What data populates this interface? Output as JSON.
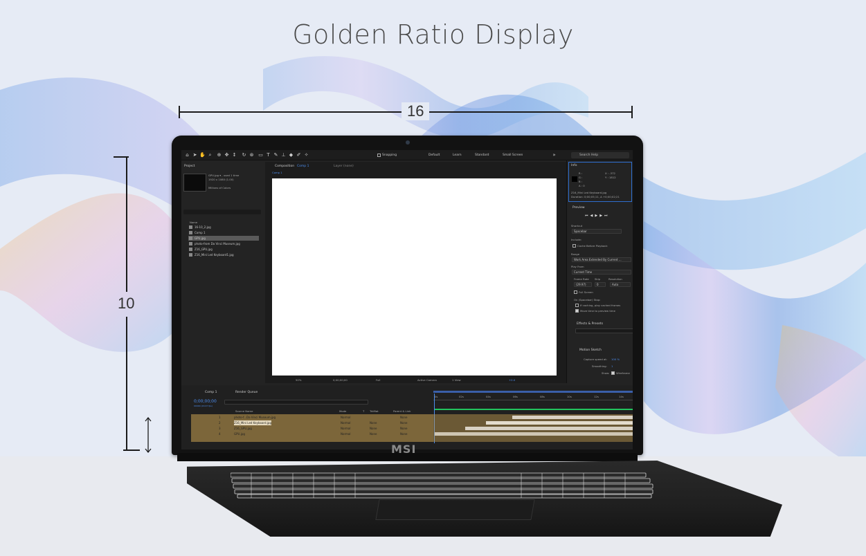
{
  "headline": "Golden Ratio Display",
  "dimensions": {
    "width_label": "16",
    "height_label": "10"
  },
  "brand_logo": "MSI",
  "colors": {
    "accent": "#2f6fd0",
    "layer_highlight": "#c8a050",
    "timeline_green": "#22c55e"
  },
  "app": {
    "toolbar": {
      "snapping_label": "Snapping",
      "workspaces": [
        "Default",
        "Learn",
        "Standard",
        "Small Screen"
      ],
      "search_placeholder": "Search Help"
    },
    "project": {
      "title": "Project",
      "selected_file": "GPU.jpg ▾ , used 1 time",
      "selected_dims": "1920 x 1080 (1.00)",
      "color_depth": "Millions of Colors",
      "column_name": "Name",
      "files": [
        "16-10_2.jpg",
        "Comp 1",
        "GPU.jpg",
        "photo-from Da Vinci Museum.jpg",
        "Z16_GPU.jpg",
        "Z16_Mini Led Keyboard1.jpg"
      ]
    },
    "composition": {
      "tab_label": "Composition",
      "comp_name": "Comp 1",
      "layer_label": "Layer (none)",
      "breadcrumb": "Comp 1",
      "zoom": "50%",
      "timecode": "0;00;00;00",
      "resolution": "Full",
      "camera": "Active Camera",
      "views": "1 View",
      "exposure": "+0.0"
    },
    "info": {
      "title": "Info",
      "r": "R :",
      "g": "G :",
      "b": "B :",
      "a": "A : 0",
      "x": "X : -372",
      "y": "Y : 1812",
      "file_line": "Z16_Mini Led Keyboard.jpg",
      "duration_line": "Duration: 0;00;05;11, Δ +0;00;02;21"
    },
    "preview": {
      "title": "Preview",
      "shortcut_label": "Shortcut",
      "shortcut_value": "Spacebar",
      "include_label": "Include:",
      "cache_before_playback": "Cache Before Playback",
      "range_label": "Range",
      "range_value": "Work Area Extended By Current ...",
      "play_from_label": "Play From",
      "play_from_value": "Current Time",
      "frame_rate_label": "Frame Rate",
      "skip_label": "Skip",
      "resolution_label": "Resolution",
      "frame_rate_value": "(29.97)",
      "skip_value": "0",
      "resolution_value": "Auto",
      "full_screen": "Full Screen",
      "on_stop_label": "On (Spacebar) Stop:",
      "if_caching": "If caching, play cached frames",
      "move_time": "Move time to preview time"
    },
    "effects": {
      "title": "Effects & Presets"
    },
    "motion_sketch": {
      "title": "Motion Sketch",
      "capture_speed_label": "Capture speed at:",
      "capture_speed_value": "100 %",
      "smoothing_label": "Smoothing:",
      "smoothing_value": "1",
      "show_label": "Show:",
      "wireframe": "Wireframe"
    },
    "timeline": {
      "comp_tab": "Comp 1",
      "render_queue": "Render Queue",
      "timecode": "0;00;00;00",
      "fps": "00000 (29.97 fps)",
      "col_source": "Source Name",
      "col_mode": "Mode",
      "col_trkmat": "T",
      "col_trkmat2": "TrkMat",
      "col_parent": "Parent & Link",
      "ruler_ticks": [
        "0s",
        "02s",
        "04s",
        "06s",
        "08s",
        "10s",
        "12s",
        "14s"
      ],
      "layers": [
        {
          "num": "1",
          "name": "photo-f...Da Vinci Museum.jpg",
          "mode": "Normal",
          "trkmat": "",
          "parent": "None"
        },
        {
          "num": "2",
          "name": "Z16_Mini Led Keyboard.jpg",
          "mode": "Normal",
          "trkmat": "None",
          "parent": "None"
        },
        {
          "num": "3",
          "name": "Z16_GPU.jpg",
          "mode": "Normal",
          "trkmat": "None",
          "parent": "None"
        },
        {
          "num": "4",
          "name": "GPU.jpg",
          "mode": "Normal",
          "trkmat": "None",
          "parent": "None"
        }
      ]
    }
  }
}
